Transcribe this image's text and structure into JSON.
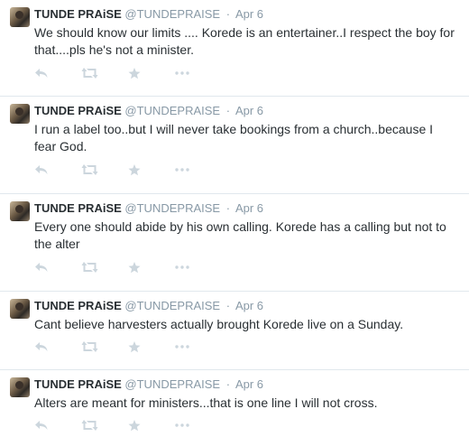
{
  "tweets": [
    {
      "name": "TUNDE PRAiSE",
      "handle": "@TUNDEPRAISE",
      "separator": "·",
      "date": "Apr 6",
      "text": "We should know our limits .... Korede is an entertainer..I respect the boy for that....pls he's not a minister."
    },
    {
      "name": "TUNDE PRAiSE",
      "handle": "@TUNDEPRAISE",
      "separator": "·",
      "date": "Apr 6",
      "text": "I run a label too..but I will never take bookings from a church..because I fear God."
    },
    {
      "name": "TUNDE PRAiSE",
      "handle": "@TUNDEPRAISE",
      "separator": "·",
      "date": "Apr 6",
      "text": "Every one should abide by his own calling. Korede has a calling but not to the alter"
    },
    {
      "name": "TUNDE PRAiSE",
      "handle": "@TUNDEPRAISE",
      "separator": "·",
      "date": "Apr 6",
      "text": "Cant believe harvesters actually brought Korede live on a Sunday."
    },
    {
      "name": "TUNDE PRAiSE",
      "handle": "@TUNDEPRAISE",
      "separator": "·",
      "date": "Apr 6",
      "text": "Alters are meant for ministers...that is one line I will not cross."
    }
  ],
  "icons": {
    "reply": "reply-icon",
    "retweet": "retweet-icon",
    "favorite": "star-icon",
    "more": "more-icon"
  },
  "colors": {
    "icon": "#ccd6dd",
    "muted": "#8899a6",
    "text": "#292f33",
    "divider": "#e1e8ed"
  }
}
